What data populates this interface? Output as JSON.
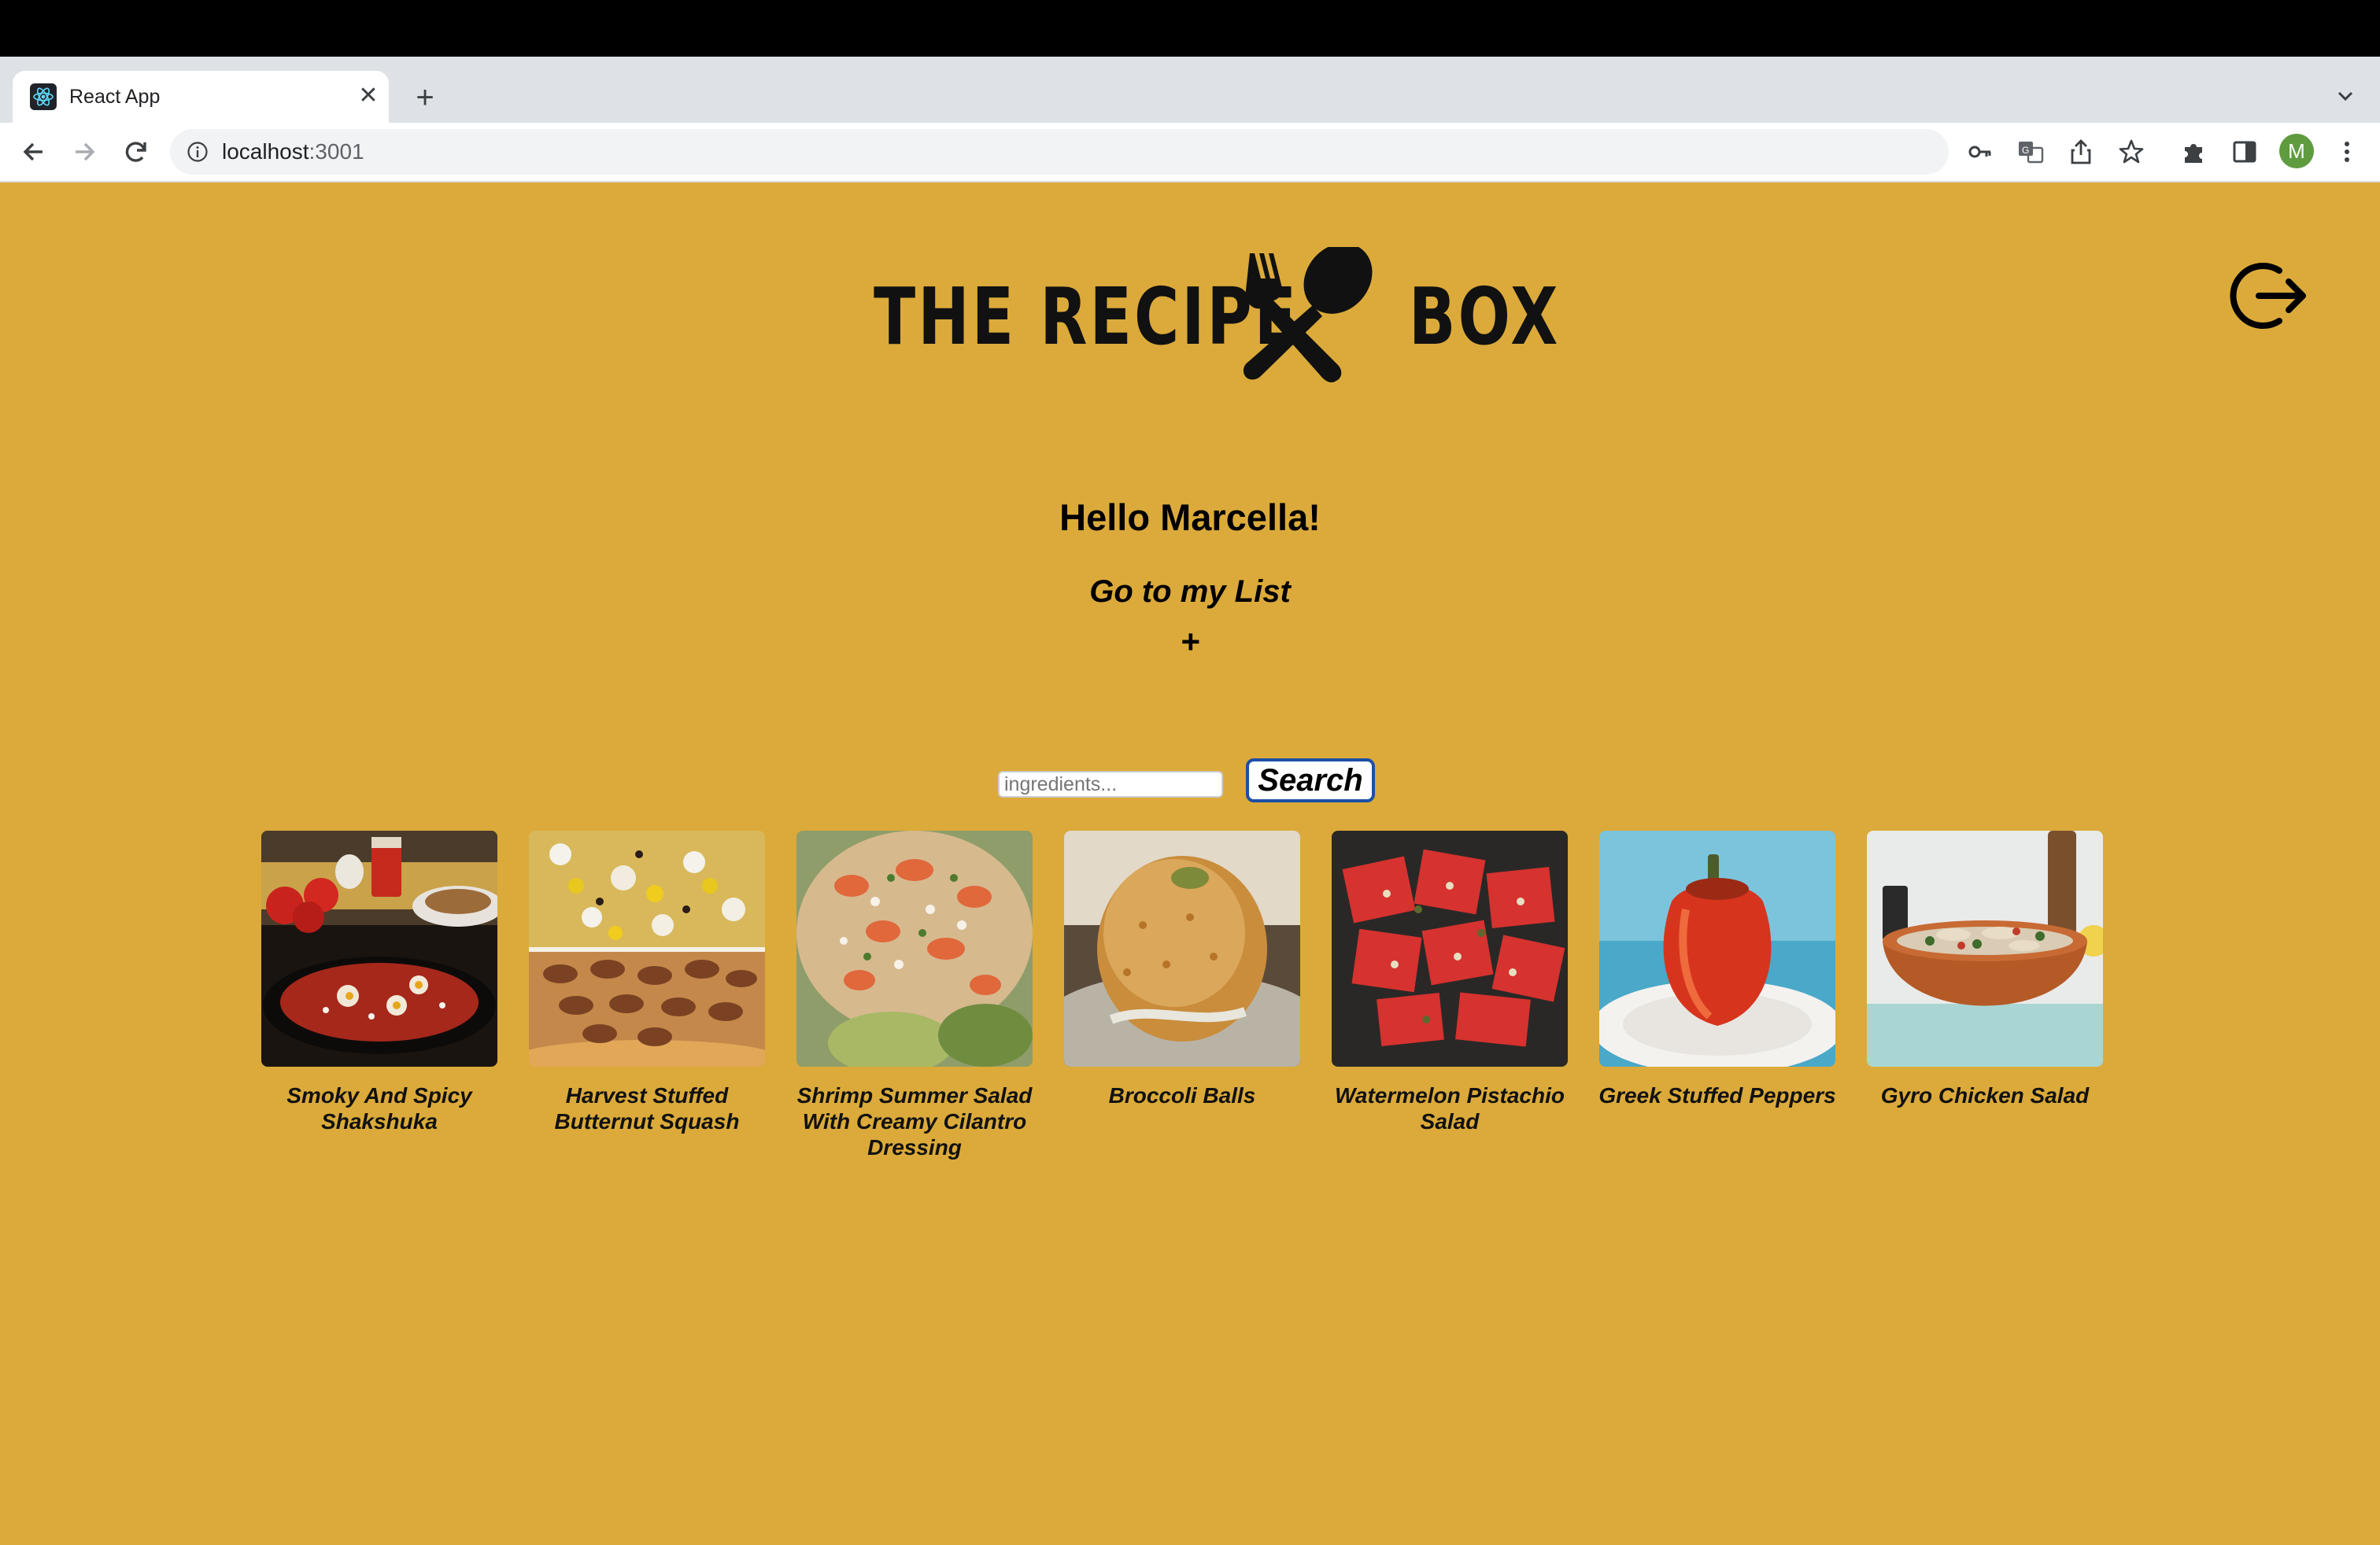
{
  "browser": {
    "tab_title": "React App",
    "new_tab_symbol": "+",
    "close_symbol": "✕",
    "url_host": "localhost",
    "url_port": ":3001",
    "profile_initial": "M",
    "accent": "#1d4fa6"
  },
  "header": {
    "logo_left": "THE RECIPE",
    "logo_right": "BOX",
    "logo_icon": "fork-spoon-icon",
    "logout_icon": "logout-icon"
  },
  "main": {
    "greeting": "Hello Marcella!",
    "go_to_list": "Go to my List",
    "add_symbol": "+",
    "search_placeholder": "ingredients...",
    "search_label": "Search",
    "background": "#dbaa3a"
  },
  "recipes": [
    {
      "title": "Smoky And Spicy Shakshuka"
    },
    {
      "title": "Harvest Stuffed Butternut Squash"
    },
    {
      "title": "Shrimp Summer Salad With Creamy Cilantro Dressing"
    },
    {
      "title": "Broccoli Balls"
    },
    {
      "title": "Watermelon Pistachio Salad"
    },
    {
      "title": "Greek Stuffed Peppers"
    },
    {
      "title": "Gyro Chicken Salad"
    }
  ]
}
